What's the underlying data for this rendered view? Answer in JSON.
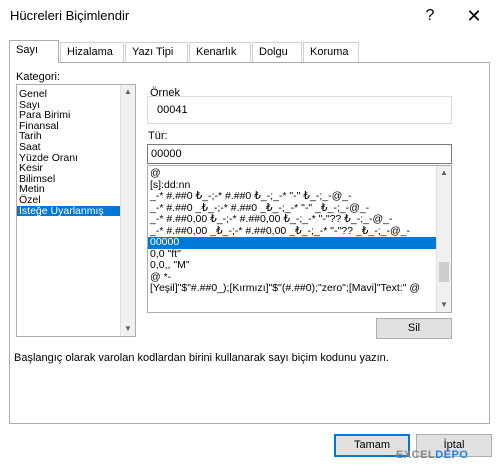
{
  "window": {
    "title": "Hücreleri Biçimlendir",
    "help": "?",
    "close": "✕"
  },
  "tabs": [
    {
      "label": "Sayı"
    },
    {
      "label": "Hizalama"
    },
    {
      "label": "Yazı Tipi"
    },
    {
      "label": "Kenarlık"
    },
    {
      "label": "Dolgu"
    },
    {
      "label": "Koruma"
    }
  ],
  "category": {
    "label": "Kategori:",
    "items": [
      "Genel",
      "Sayı",
      "Para Birimi",
      "Finansal",
      "Tarih",
      "Saat",
      "Yüzde Oranı",
      "Kesir",
      "Bilimsel",
      "Metin",
      "Özel",
      "İsteğe Uyarlanmış"
    ],
    "selected": "İsteğe Uyarlanmış"
  },
  "sample": {
    "label": "Örnek",
    "value": "00041"
  },
  "type": {
    "label": "Tür:",
    "value": "00000",
    "formats": [
      "@",
      "[s]:dd:nn",
      "_-* #.##0 ₺_-;-* #.##0 ₺_-;_-* \"-\" ₺_-;_-@_-",
      "_-* #.##0 _₺_-;-* #.##0 _₺_-;_-* \"-\" _₺_-;_-@_-",
      "_-* #.##0,00 ₺_-;-* #.##0,00 ₺_-;_-* \"-\"?? ₺_-;_-@_-",
      "_-* #.##0,00 _₺_-;-* #.##0,00 _₺_-;_-* \"-\"?? _₺_-;_-@_-",
      "00000",
      "0,0 \"ft\"",
      "0,0,, \"M\"",
      "@ *-",
      "[Yeşil]\"$\"#.##0_);[Kırmızı]\"$\"(#.##0);\"zero\";[Mavi]\"Text:\" @"
    ],
    "selected": "00000"
  },
  "buttons": {
    "delete": "Sil",
    "ok": "Tamam",
    "cancel": "İptal"
  },
  "description": "Başlangıç olarak varolan kodlardan birini kullanarak sayı biçim kodunu yazın.",
  "watermark": {
    "part1": "EXCEL",
    "part2": "DEPO"
  }
}
